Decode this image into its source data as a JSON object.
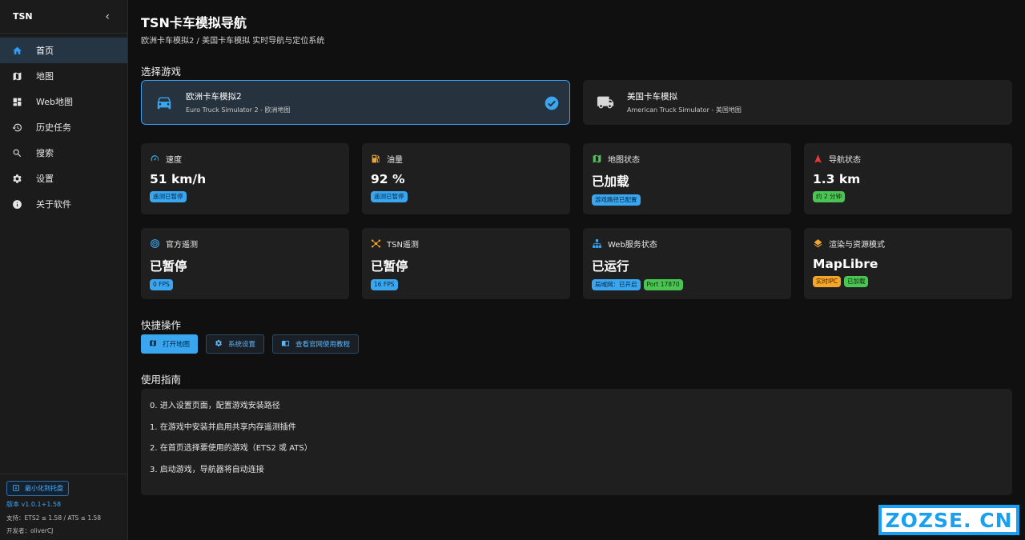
{
  "sidebar": {
    "brand": "TSN",
    "collapse_icon": "chevron-left-icon",
    "items": [
      {
        "label": "首页",
        "icon": "home-icon",
        "active": true
      },
      {
        "label": "地图",
        "icon": "map-icon"
      },
      {
        "label": "Web地图",
        "icon": "dashboard-icon"
      },
      {
        "label": "历史任务",
        "icon": "history-icon"
      },
      {
        "label": "搜索",
        "icon": "search-icon"
      },
      {
        "label": "设置",
        "icon": "gear-icon"
      },
      {
        "label": "关于软件",
        "icon": "info-icon"
      }
    ],
    "tray_button": "最小化到托盘",
    "version": "版本 v1.0.1+1.58",
    "support": "支持：ETS2 ≤ 1.58 / ATS ≤ 1.58",
    "developer": "开发者：oliverCJ"
  },
  "header": {
    "title": "TSN卡车模拟导航",
    "subtitle": "欧洲卡车模拟2 / 美国卡车模拟 实时导航与定位系统"
  },
  "game_select": {
    "title": "选择游戏",
    "games": [
      {
        "name": "欧洲卡车模拟2",
        "desc": "Euro Truck Simulator 2 - 欧洲地图",
        "selected": true,
        "icon": "car-icon"
      },
      {
        "name": "美国卡车模拟",
        "desc": "American Truck Simulator - 美国地图",
        "selected": false,
        "icon": "truck-icon"
      }
    ]
  },
  "stats": [
    {
      "label": "速度",
      "value": "51 km/h",
      "icon": "speedometer-icon",
      "badges": [
        {
          "text": "遥测已暂停",
          "color": "blue"
        }
      ]
    },
    {
      "label": "油量",
      "value": "92 %",
      "icon": "fuel-icon",
      "badges": [
        {
          "text": "遥测已暂停",
          "color": "blue"
        }
      ]
    },
    {
      "label": "地图状态",
      "value": "已加载",
      "icon": "map-icon",
      "badges": [
        {
          "text": "游戏路径已配置",
          "color": "blue"
        }
      ]
    },
    {
      "label": "导航状态",
      "value": "1.3 km",
      "icon": "navigation-arrow-icon",
      "badges": [
        {
          "text": "约 2 分钟",
          "color": "green"
        }
      ]
    },
    {
      "label": "官方遥测",
      "value": "已暂停",
      "icon": "radar-icon",
      "badges": [
        {
          "text": "0 FPS",
          "color": "blue"
        }
      ]
    },
    {
      "label": "TSN遥测",
      "value": "已暂停",
      "icon": "hub-icon",
      "badges": [
        {
          "text": "16 FPS",
          "color": "blue"
        }
      ]
    },
    {
      "label": "Web服务状态",
      "value": "已运行",
      "icon": "network-icon",
      "badges": [
        {
          "text": "局域网：已开启",
          "color": "blue"
        },
        {
          "text": "Port 17870",
          "color": "green"
        }
      ]
    },
    {
      "label": "渲染与资源模式",
      "value": "MapLibre",
      "icon": "layers-icon",
      "badges": [
        {
          "text": "实时IPC",
          "color": "orange"
        },
        {
          "text": "已加载",
          "color": "green"
        }
      ]
    }
  ],
  "quick": {
    "title": "快捷操作",
    "buttons": [
      {
        "label": "打开地图",
        "icon": "map-icon"
      },
      {
        "label": "系统设置",
        "icon": "gear-icon"
      },
      {
        "label": "查看官网使用教程",
        "icon": "book-icon"
      }
    ]
  },
  "guide": {
    "title": "使用指南",
    "lines": [
      "0. 进入设置页面，配置游戏安装路径",
      "1. 在游戏中安装并启用共享内存遥测插件",
      "2. 在首页选择要使用的游戏（ETS2 或 ATS）",
      "3. 启动游戏，导航器将自动连接"
    ]
  },
  "watermark": "ZOZSE. CN",
  "colors": {
    "accent": "#3aa6f0",
    "green": "#4cc454",
    "orange": "#f4a52a",
    "bg": "#101010",
    "card": "#1f1f1f"
  }
}
